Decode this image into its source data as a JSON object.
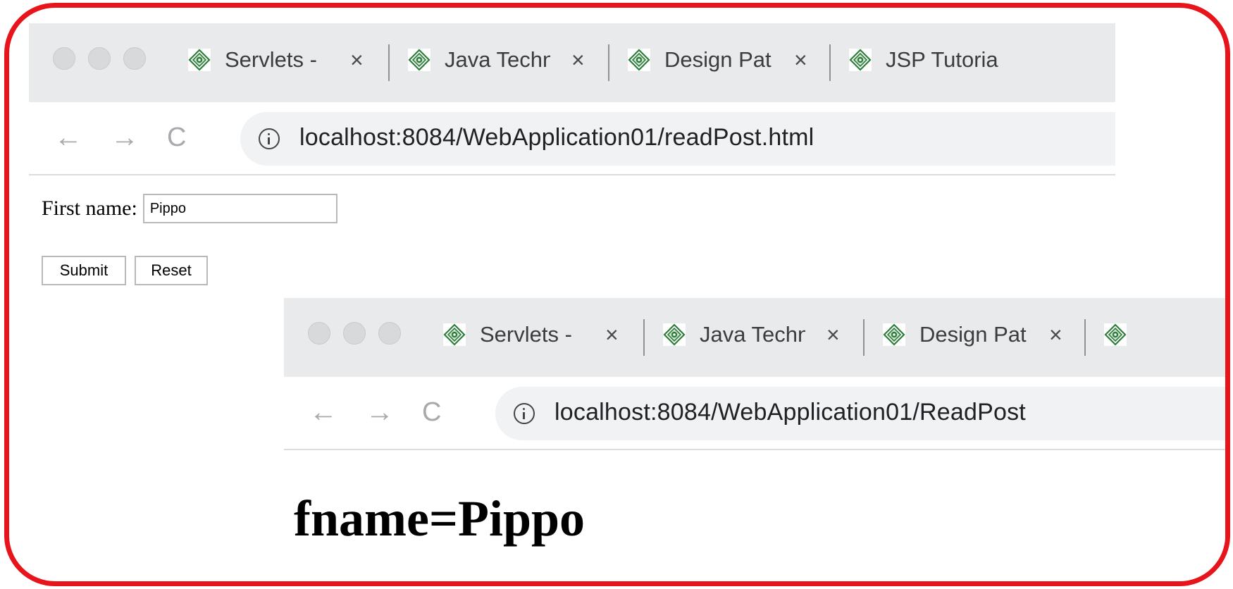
{
  "window_top": {
    "tabs": [
      {
        "title": "Servlets - ",
        "icon": "site-favicon-icon",
        "close": "×"
      },
      {
        "title": "Java Techn",
        "icon": "site-favicon-icon",
        "close": "×"
      },
      {
        "title": "Design Pat",
        "icon": "site-favicon-icon",
        "close": "×"
      },
      {
        "title": "JSP Tutoria",
        "icon": "site-favicon-icon"
      }
    ],
    "nav": {
      "back": "←",
      "forward": "→",
      "reload": "C"
    },
    "address": {
      "host": "localhost",
      "path": ":8084/WebApplication01/readPost.html"
    },
    "form": {
      "first_name_label": "First name:",
      "first_name_value": "Pippo",
      "submit_label": "Submit",
      "reset_label": "Reset"
    }
  },
  "window_bottom": {
    "tabs": [
      {
        "title": "Servlets - ",
        "icon": "site-favicon-icon",
        "close": "×"
      },
      {
        "title": "Java Techn",
        "icon": "site-favicon-icon",
        "close": "×"
      },
      {
        "title": "Design Pat",
        "icon": "site-favicon-icon",
        "close": "×"
      },
      {
        "title": "",
        "icon": "site-favicon-icon"
      }
    ],
    "nav": {
      "back": "←",
      "forward": "→",
      "reload": "C"
    },
    "address": {
      "host": "localhost",
      "path": ":8084/WebApplication01/ReadPost"
    },
    "result_text": "fname=Pippo"
  },
  "colors": {
    "frame_border": "#e8141b",
    "tabstrip_bg": "#e9eaec",
    "omnibox_bg": "#f1f2f4",
    "favicon_green": "#2f7d3a"
  }
}
